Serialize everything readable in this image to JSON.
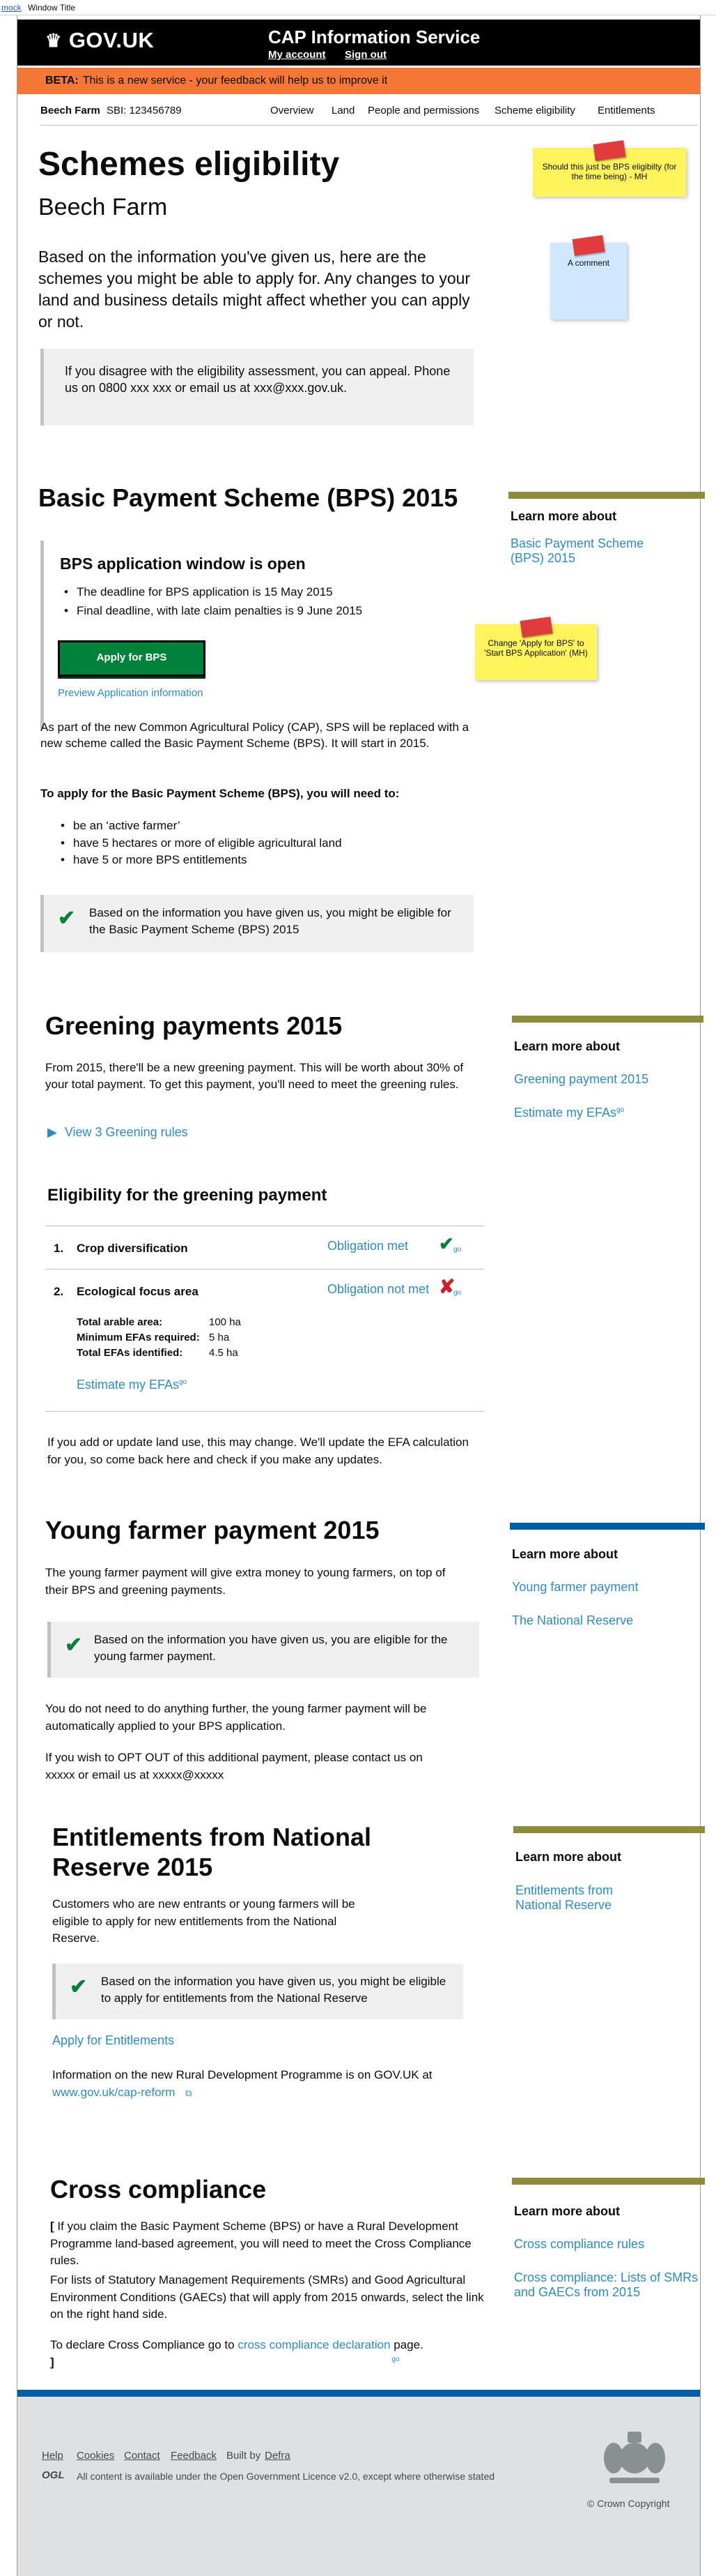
{
  "window": {
    "mock_label": "mock",
    "title": "Window Title"
  },
  "header": {
    "logo_text": "GOV.UK",
    "service_name": "CAP Information Service",
    "my_account": "My account",
    "sign_out": "Sign out"
  },
  "beta": {
    "tag": "BETA:",
    "text": "This is a new service - your feedback will help us to improve it"
  },
  "subnav": {
    "farm_name": "Beech Farm",
    "sbi": "SBI: 123456789",
    "links": [
      "Overview",
      "Land",
      "People and permissions",
      "Scheme eligibility",
      "Entitlements"
    ]
  },
  "intro": {
    "title": "Schemes eligibility",
    "subtitle": "Beech Farm",
    "lead": "Based on the information you've given us, here are the schemes you might be able to apply for. Any changes to your land and business details might affect whether you can apply or not.",
    "appeal": "If you disagree with the eligibility assessment, you can appeal. Phone us on 0800 xxx xxx or email us at xxx@xxx.gov.uk."
  },
  "notes": {
    "note1": "Should this just be BPS eligibilty (for the time being) - MH",
    "note2": "A comment",
    "note3": "Change 'Apply for BPS' to 'Start BPS Application' (MH)"
  },
  "bps": {
    "title": "Basic Payment Scheme (BPS) 2015",
    "window_title": "BPS application window is open",
    "deadlines": [
      "The deadline for BPS application is 15 May 2015",
      "Final deadline, with late claim penalties is 9 June 2015"
    ],
    "apply_button": "Apply for BPS",
    "preview_link": "Preview Application information",
    "para1": "As part of the new Common Agricultural Policy (CAP), SPS will be replaced with a new scheme called the Basic Payment Scheme (BPS). It will start in 2015.",
    "need_heading": "To apply for the Basic Payment Scheme (BPS), you will need to:",
    "needs": [
      "be an ‘active farmer’",
      "have 5 hectares or more of eligible agricultural land",
      "have 5 or more BPS entitlements"
    ],
    "eligible": "Based on the information you have given us, you might be eligible for the Basic Payment Scheme (BPS) 2015",
    "related_title": "Learn more about",
    "related_links": [
      "Basic Payment Scheme (BPS) 2015"
    ]
  },
  "greening": {
    "title": "Greening payments 2015",
    "intro": "From 2015, there'll be a new greening payment. This will be worth about 30% of your total payment. To get this payment, you'll need to meet the greening rules.",
    "view_rules": "View 3 Greening rules",
    "eligibility_title": "Eligibility for the greening payment",
    "rows": [
      {
        "num": "1.",
        "label": "Crop diversification",
        "status": "Obligation met",
        "go": "go"
      },
      {
        "num": "2.",
        "label": "Ecological focus area",
        "status": "Obligation not met",
        "go": "go"
      }
    ],
    "efa_details": [
      {
        "label": "Total arable area:",
        "value": "100 ha"
      },
      {
        "label": "Minimum EFAs required:",
        "value": "5 ha"
      },
      {
        "label": "Total EFAs identified:",
        "value": "4.5 ha"
      }
    ],
    "estimate_link": "Estimate my EFAs",
    "go": "go",
    "update_note": "If you add or update land use, this may change. We'll update the EFA calculation for you, so come back here and check if you make any updates.",
    "related_title": "Learn more about",
    "related_links": [
      "Greening payment 2015",
      "Estimate my EFAs"
    ]
  },
  "young_farmer": {
    "title": "Young farmer payment 2015",
    "intro": "The young farmer payment will give extra money to young farmers, on top of their BPS and greening payments.",
    "eligible": "Based on the information you have given us, you are eligible for the young farmer payment.",
    "para1": "You do not need to do anything further, the young farmer payment will be automatically applied to your BPS application.",
    "para2": "If you wish to OPT OUT of this additional payment, please contact us on xxxxx or email us at xxxxx@xxxxx",
    "related_title": "Learn more about",
    "related_links": [
      "Young farmer payment",
      "The National Reserve"
    ]
  },
  "entitlements": {
    "title": "Entitlements from National Reserve 2015",
    "intro": "Customers who are new entrants or young farmers will be eligible to apply for new entitlements from the National Reserve.",
    "eligible": "Based on the information you have given us, you might be eligible to apply for entitlements from the National Reserve",
    "apply_link": "Apply for Entitlements",
    "rdp_text": "Information on the new Rural Development Programme is on GOV.UK at",
    "rdp_link": "www.gov.uk/cap-reform",
    "related_title": "Learn more about",
    "related_links": [
      "Entitlements from National Reserve"
    ]
  },
  "cross_compliance": {
    "title": "Cross compliance",
    "open_bracket": "[",
    "close_bracket": "]",
    "para1": "If you claim the Basic Payment Scheme (BPS) or have a Rural Development Programme land-based agreement, you will need to meet the Cross Compliance rules.",
    "para2": "For lists of Statutory Management Requirements (SMRs) and Good Agricultural Environment Conditions (GAECs) that will apply from 2015 onwards, select the link on the right hand side.",
    "para3_pre": "To declare Cross Compliance go to",
    "para3_link": "cross compliance declaration",
    "para3_post": "page.",
    "go": "go",
    "related_title": "Learn more about",
    "related_links": [
      "Cross compliance rules",
      "Cross compliance: Lists of SMRs and GAECs from 2015"
    ]
  },
  "footer": {
    "links": [
      "Help",
      "Cookies",
      "Contact",
      "Feedback"
    ],
    "built_by": "Built by",
    "built_by_link": "Defra",
    "ogl": "OGL",
    "licence": "All content is available under the Open Government Licence v2.0, except where otherwise stated",
    "copyright": "© Crown Copyright"
  },
  "colors": {
    "header_bg": "#000000",
    "beta_bg": "#f47738",
    "link": "#2b8cc4",
    "button": "#00823b",
    "related_bar": "#8c8c3a",
    "young_bar": "#005ea5",
    "tick": "#00823b",
    "cross": "#d21f2a"
  }
}
